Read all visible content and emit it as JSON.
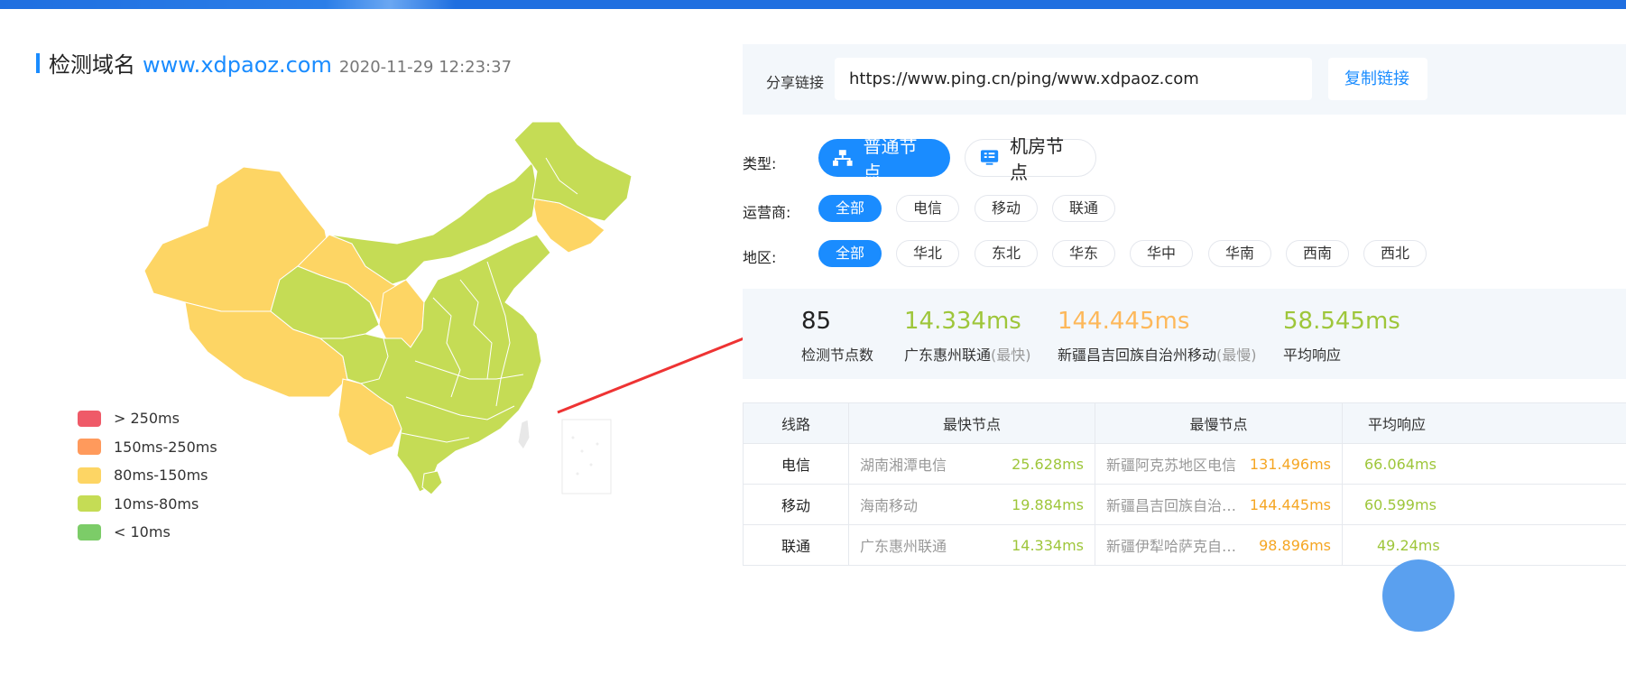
{
  "title": {
    "label": "检测域名",
    "domain": "www.xdpaoz.com",
    "time": "2020-11-29 12:23:37"
  },
  "legend": [
    {
      "label": "> 250ms",
      "color": "#ef5a68"
    },
    {
      "label": "150ms-250ms",
      "color": "#ff9a5c"
    },
    {
      "label": "80ms-150ms",
      "color": "#fdd564"
    },
    {
      "label": "10ms-80ms",
      "color": "#c5dc55"
    },
    {
      "label": "< 10ms",
      "color": "#7ccc68"
    }
  ],
  "share": {
    "label": "分享链接",
    "url": "https://www.ping.cn/ping/www.xdpaoz.com",
    "copy_label": "复制链接"
  },
  "type_filter": {
    "label": "类型:",
    "options": [
      {
        "label": "普通节点",
        "icon": "network-icon",
        "active": true
      },
      {
        "label": "机房节点",
        "icon": "server-icon",
        "active": false
      }
    ]
  },
  "isp_filter": {
    "label": "运营商:",
    "options": [
      "全部",
      "电信",
      "移动",
      "联通"
    ],
    "active": "全部"
  },
  "region_filter": {
    "label": "地区:",
    "options": [
      "全部",
      "华北",
      "东北",
      "华东",
      "华中",
      "华南",
      "西南",
      "西北"
    ],
    "active": "全部"
  },
  "stats": {
    "node_count": {
      "value": "85",
      "label": "检测节点数"
    },
    "fastest": {
      "value": "14.334ms",
      "label": "广东惠州联通",
      "note": "(最快)"
    },
    "slowest": {
      "value": "144.445ms",
      "label": "新疆昌吉回族自治州移动",
      "note": "(最慢)"
    },
    "average": {
      "value": "58.545ms",
      "label": "平均响应"
    }
  },
  "table": {
    "headers": [
      "线路",
      "最快节点",
      "最慢节点",
      "平均响应"
    ],
    "rows": [
      {
        "line": "电信",
        "fast_node": "湖南湘潭电信",
        "fast_ms": "25.628ms",
        "slow_node": "新疆阿克苏地区电信",
        "slow_ms": "131.496ms",
        "avg": "66.064ms"
      },
      {
        "line": "移动",
        "fast_node": "海南移动",
        "fast_ms": "19.884ms",
        "slow_node": "新疆昌吉回族自治州移动",
        "slow_ms": "144.445ms",
        "avg": "60.599ms"
      },
      {
        "line": "联通",
        "fast_node": "广东惠州联通",
        "fast_ms": "14.334ms",
        "slow_node": "新疆伊犁哈萨克自治州联通",
        "slow_ms": "98.896ms",
        "avg": "49.24ms"
      }
    ]
  },
  "colors": {
    "accent": "#1a8cff",
    "fast_green": "#9ec63a",
    "slow_orange": "#f5a623",
    "map_green": "#c5dc55",
    "map_yellow": "#fdd564"
  }
}
